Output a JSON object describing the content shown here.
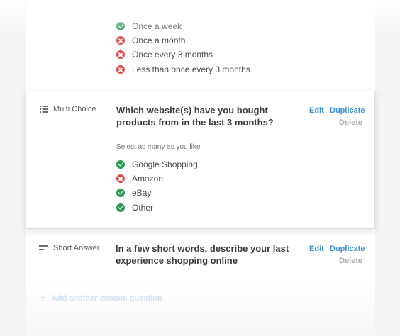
{
  "previous_question": {
    "options": [
      {
        "label": "Once a week",
        "status": "correct"
      },
      {
        "label": "Once a month",
        "status": "incorrect"
      },
      {
        "label": "Once every 3 months",
        "status": "incorrect"
      },
      {
        "label": "Less than once every 3 months",
        "status": "incorrect"
      }
    ]
  },
  "multi_choice_question": {
    "type_label": "Multi Choice",
    "type_icon": "list-icon",
    "title": "Which website(s) have you bought products from in the last 3 months?",
    "hint": "Select as many as you like",
    "edit_label": "Edit",
    "duplicate_label": "Duplicate",
    "delete_label": "Delete",
    "options": [
      {
        "label": "Google Shopping",
        "status": "correct"
      },
      {
        "label": "Amazon",
        "status": "incorrect"
      },
      {
        "label": "eBay",
        "status": "correct"
      },
      {
        "label": "Other",
        "status": "correct"
      }
    ]
  },
  "short_answer_question": {
    "type_label": "Short Answer",
    "type_icon": "short-text-icon",
    "title": "In a few short words, describe your last experience shopping online",
    "edit_label": "Edit",
    "duplicate_label": "Duplicate",
    "delete_label": "Delete"
  },
  "add_question": {
    "label": "Add another custom question"
  },
  "colors": {
    "accent": "#3a8ed6",
    "correct": "#2c9a55",
    "incorrect": "#de4b49"
  }
}
